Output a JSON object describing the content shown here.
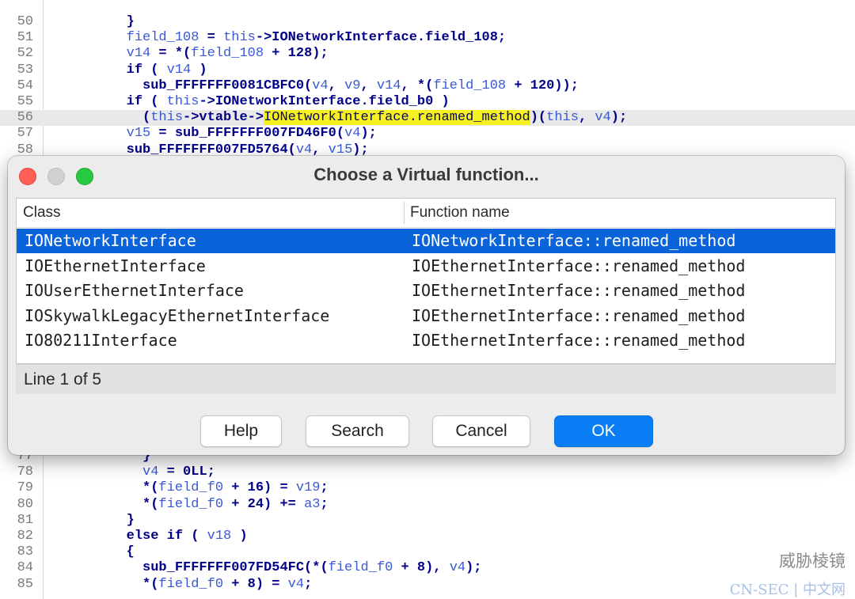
{
  "editor": {
    "lines_top": [
      {
        "num": "50",
        "parts": [
          [
            "plain",
            "        }"
          ]
        ]
      },
      {
        "num": "51",
        "parts": [
          [
            "plain",
            "        "
          ],
          [
            "var",
            "field_108"
          ],
          [
            "plain",
            " = "
          ],
          [
            "var",
            "this"
          ],
          [
            "plain",
            "->IONetworkInterface.field_108;"
          ]
        ]
      },
      {
        "num": "52",
        "parts": [
          [
            "plain",
            "        "
          ],
          [
            "var",
            "v14"
          ],
          [
            "plain",
            " = *("
          ],
          [
            "var",
            "field_108"
          ],
          [
            "plain",
            " + 128);"
          ]
        ]
      },
      {
        "num": "53",
        "parts": [
          [
            "plain",
            "        if ( "
          ],
          [
            "var",
            "v14"
          ],
          [
            "plain",
            " )"
          ]
        ]
      },
      {
        "num": "54",
        "parts": [
          [
            "plain",
            "          sub_FFFFFFF0081CBFC0("
          ],
          [
            "var",
            "v4"
          ],
          [
            "plain",
            ", "
          ],
          [
            "var",
            "v9"
          ],
          [
            "plain",
            ", "
          ],
          [
            "var",
            "v14"
          ],
          [
            "plain",
            ", *("
          ],
          [
            "var",
            "field_108"
          ],
          [
            "plain",
            " + 120));"
          ]
        ]
      },
      {
        "num": "55",
        "parts": [
          [
            "plain",
            "        if ( "
          ],
          [
            "var",
            "this"
          ],
          [
            "plain",
            "->IONetworkInterface.field_b0 )"
          ]
        ]
      },
      {
        "num": "56",
        "highlight": true,
        "parts": [
          [
            "plain",
            "          ("
          ],
          [
            "var",
            "this"
          ],
          [
            "plain",
            "->vtable->"
          ],
          [
            "hl",
            "IONetworkInterface.renamed_method"
          ],
          [
            "plain",
            ")("
          ],
          [
            "var",
            "this"
          ],
          [
            "plain",
            ", "
          ],
          [
            "var",
            "v4"
          ],
          [
            "plain",
            ");"
          ]
        ]
      },
      {
        "num": "57",
        "parts": [
          [
            "plain",
            "        "
          ],
          [
            "var",
            "v15"
          ],
          [
            "plain",
            " = sub_FFFFFFF007FD46F0("
          ],
          [
            "var",
            "v4"
          ],
          [
            "plain",
            ");"
          ]
        ]
      },
      {
        "num": "58",
        "parts": [
          [
            "plain",
            "        sub_FFFFFFF007FD5764("
          ],
          [
            "var",
            "v4"
          ],
          [
            "plain",
            ", "
          ],
          [
            "var",
            "v15"
          ],
          [
            "plain",
            ");"
          ]
        ]
      }
    ],
    "lines_bottom": [
      {
        "num": "77",
        "parts": [
          [
            "plain",
            "          }"
          ]
        ]
      },
      {
        "num": "78",
        "parts": [
          [
            "plain",
            "          "
          ],
          [
            "var",
            "v4"
          ],
          [
            "plain",
            " = 0LL;"
          ]
        ]
      },
      {
        "num": "79",
        "parts": [
          [
            "plain",
            "          *("
          ],
          [
            "var",
            "field_f0"
          ],
          [
            "plain",
            " + 16) = "
          ],
          [
            "var",
            "v19"
          ],
          [
            "plain",
            ";"
          ]
        ]
      },
      {
        "num": "80",
        "parts": [
          [
            "plain",
            "          *("
          ],
          [
            "var",
            "field_f0"
          ],
          [
            "plain",
            " + 24) += "
          ],
          [
            "var",
            "a3"
          ],
          [
            "plain",
            ";"
          ]
        ]
      },
      {
        "num": "81",
        "parts": [
          [
            "plain",
            "        }"
          ]
        ]
      },
      {
        "num": "82",
        "parts": [
          [
            "plain",
            "        else if ( "
          ],
          [
            "var",
            "v18"
          ],
          [
            "plain",
            " )"
          ]
        ]
      },
      {
        "num": "83",
        "parts": [
          [
            "plain",
            "        {"
          ]
        ]
      },
      {
        "num": "84",
        "parts": [
          [
            "plain",
            "          sub_FFFFFFF007FD54FC(*("
          ],
          [
            "var",
            "field_f0"
          ],
          [
            "plain",
            " + 8), "
          ],
          [
            "var",
            "v4"
          ],
          [
            "plain",
            ");"
          ]
        ]
      },
      {
        "num": "85",
        "parts": [
          [
            "plain",
            "          *("
          ],
          [
            "var",
            "field_f0"
          ],
          [
            "plain",
            " + 8) = "
          ],
          [
            "var",
            "v4"
          ],
          [
            "plain",
            ";"
          ]
        ]
      }
    ]
  },
  "dialog": {
    "title": "Choose a Virtual function...",
    "columns": {
      "class": "Class",
      "function": "Function name"
    },
    "rows": [
      {
        "class": "IONetworkInterface",
        "function": "IONetworkInterface::renamed_method",
        "selected": true
      },
      {
        "class": "IOEthernetInterface",
        "function": "IOEthernetInterface::renamed_method",
        "selected": false
      },
      {
        "class": "IOUserEthernetInterface",
        "function": "IOEthernetInterface::renamed_method",
        "selected": false
      },
      {
        "class": "IOSkywalkLegacyEthernetInterface",
        "function": "IOEthernetInterface::renamed_method",
        "selected": false
      },
      {
        "class": "IO80211Interface",
        "function": "IOEthernetInterface::renamed_method",
        "selected": false
      }
    ],
    "status": "Line 1 of 5",
    "buttons": {
      "help": "Help",
      "search": "Search",
      "cancel": "Cancel",
      "ok": "OK"
    },
    "colors": {
      "selection": "#0b63d9",
      "ok_button": "#0a7ef5",
      "close": "#ff5f57",
      "maximize": "#28c840"
    }
  },
  "watermark": {
    "line1": "威胁棱镜",
    "line2": "CN-SEC | 中文网"
  }
}
